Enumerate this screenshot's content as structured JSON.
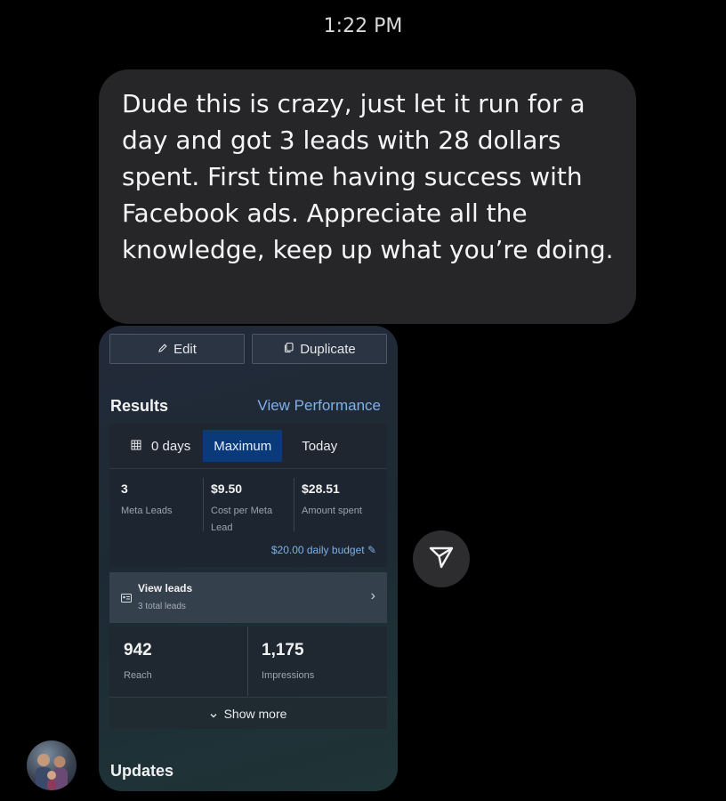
{
  "header": {
    "timestamp": "1:22 PM"
  },
  "message": {
    "text": "Dude this is crazy, just let it run for a day and got 3 leads with 28 dollars spent. First time having success with Facebook ads. Appreciate all the knowledge, keep up what you’re doing."
  },
  "shared_card": {
    "edit_label": "Edit",
    "duplicate_label": "Duplicate",
    "results_title": "Results",
    "view_performance": "View Performance",
    "tabs": {
      "days": " 0 days",
      "maximum": "Maximum",
      "today": "Today",
      "selected": "Maximum"
    },
    "metrics": [
      {
        "value": "3",
        "label": "Meta Leads"
      },
      {
        "value": "$9.50",
        "label": "Cost per Meta Lead"
      },
      {
        "value": "$28.51",
        "label": "Amount spent"
      }
    ],
    "budget": "$20.00 daily budget",
    "view_leads": {
      "title": "View leads",
      "subtitle": "3 total leads"
    },
    "reach": {
      "value": "942",
      "label": "Reach"
    },
    "impressions": {
      "value": "1,175",
      "label": "Impressions"
    },
    "show_more": "Show more",
    "updates_title": "Updates"
  },
  "colors": {
    "accent_link": "#7fb0e8",
    "selected_tab": "#0a3a7a",
    "bubble": "#262629"
  },
  "icons": [
    "pencil-icon",
    "duplicate-icon",
    "calendar-icon",
    "lead-card-icon",
    "chevron-right-icon",
    "chevron-down-icon",
    "send-icon"
  ]
}
